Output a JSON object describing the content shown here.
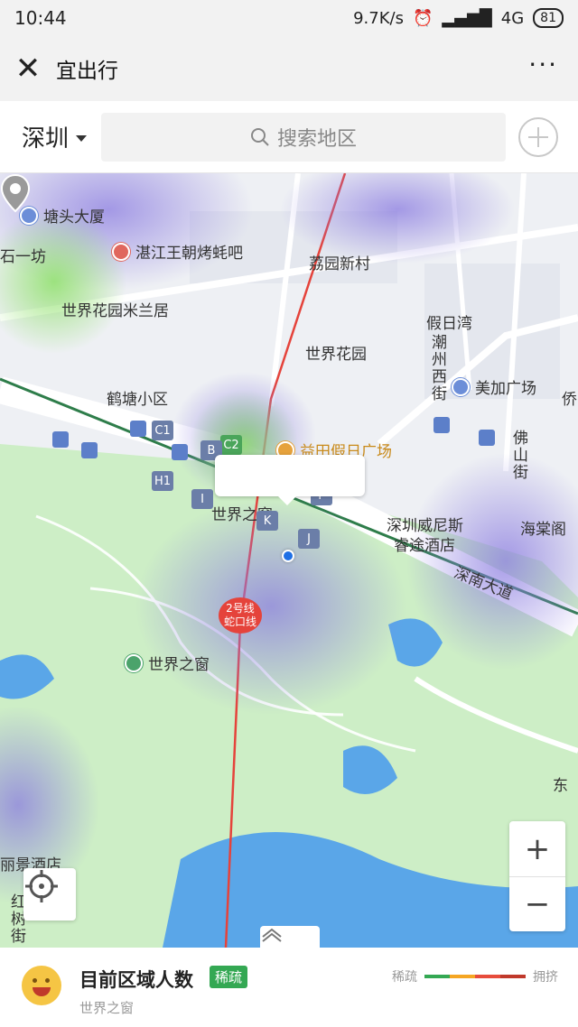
{
  "status_bar": {
    "time": "10:44",
    "network_speed": "9.7K/s",
    "network": "4G",
    "battery": "81"
  },
  "title_bar": {
    "title": "宜出行",
    "more": "···"
  },
  "search": {
    "city": "深圳",
    "placeholder": "搜索地区"
  },
  "map": {
    "pois": [
      {
        "label": "塘头大厦"
      },
      {
        "label": "石一坊"
      },
      {
        "label": "湛江王朝烤蚝吧"
      },
      {
        "label": "荔园新村"
      },
      {
        "label": "世界花园米兰居"
      },
      {
        "label": "假日湾"
      },
      {
        "label": "世界花园"
      },
      {
        "label": "潮州西街"
      },
      {
        "label": "鹤塘小区"
      },
      {
        "label": "美加广场"
      },
      {
        "label": "益田假日广场"
      },
      {
        "label": "佛山街"
      },
      {
        "label": "世界之窗"
      },
      {
        "label": "深圳威尼斯"
      },
      {
        "label": "睿途酒店"
      },
      {
        "label": "海棠阁"
      },
      {
        "label": "深南大道"
      },
      {
        "label": "世界之窗"
      },
      {
        "label": "东"
      },
      {
        "label": "丽景酒店"
      },
      {
        "label": "红树街"
      },
      {
        "label": "侨"
      }
    ],
    "exits": [
      "C1",
      "C2",
      "B",
      "H1",
      "K",
      "J",
      "I",
      "F"
    ],
    "metro_badge": {
      "line1": "2号线",
      "line2": "蛇口线"
    },
    "zoom_in": "+",
    "zoom_out": "−"
  },
  "panel": {
    "title": "目前区域人数",
    "badge": "稀疏",
    "subtitle": "世界之窗",
    "legend_low": "稀疏",
    "legend_high": "拥挤",
    "legend_colors": [
      "#34a853",
      "#f5a623",
      "#e74c3c",
      "#c0392b"
    ]
  }
}
